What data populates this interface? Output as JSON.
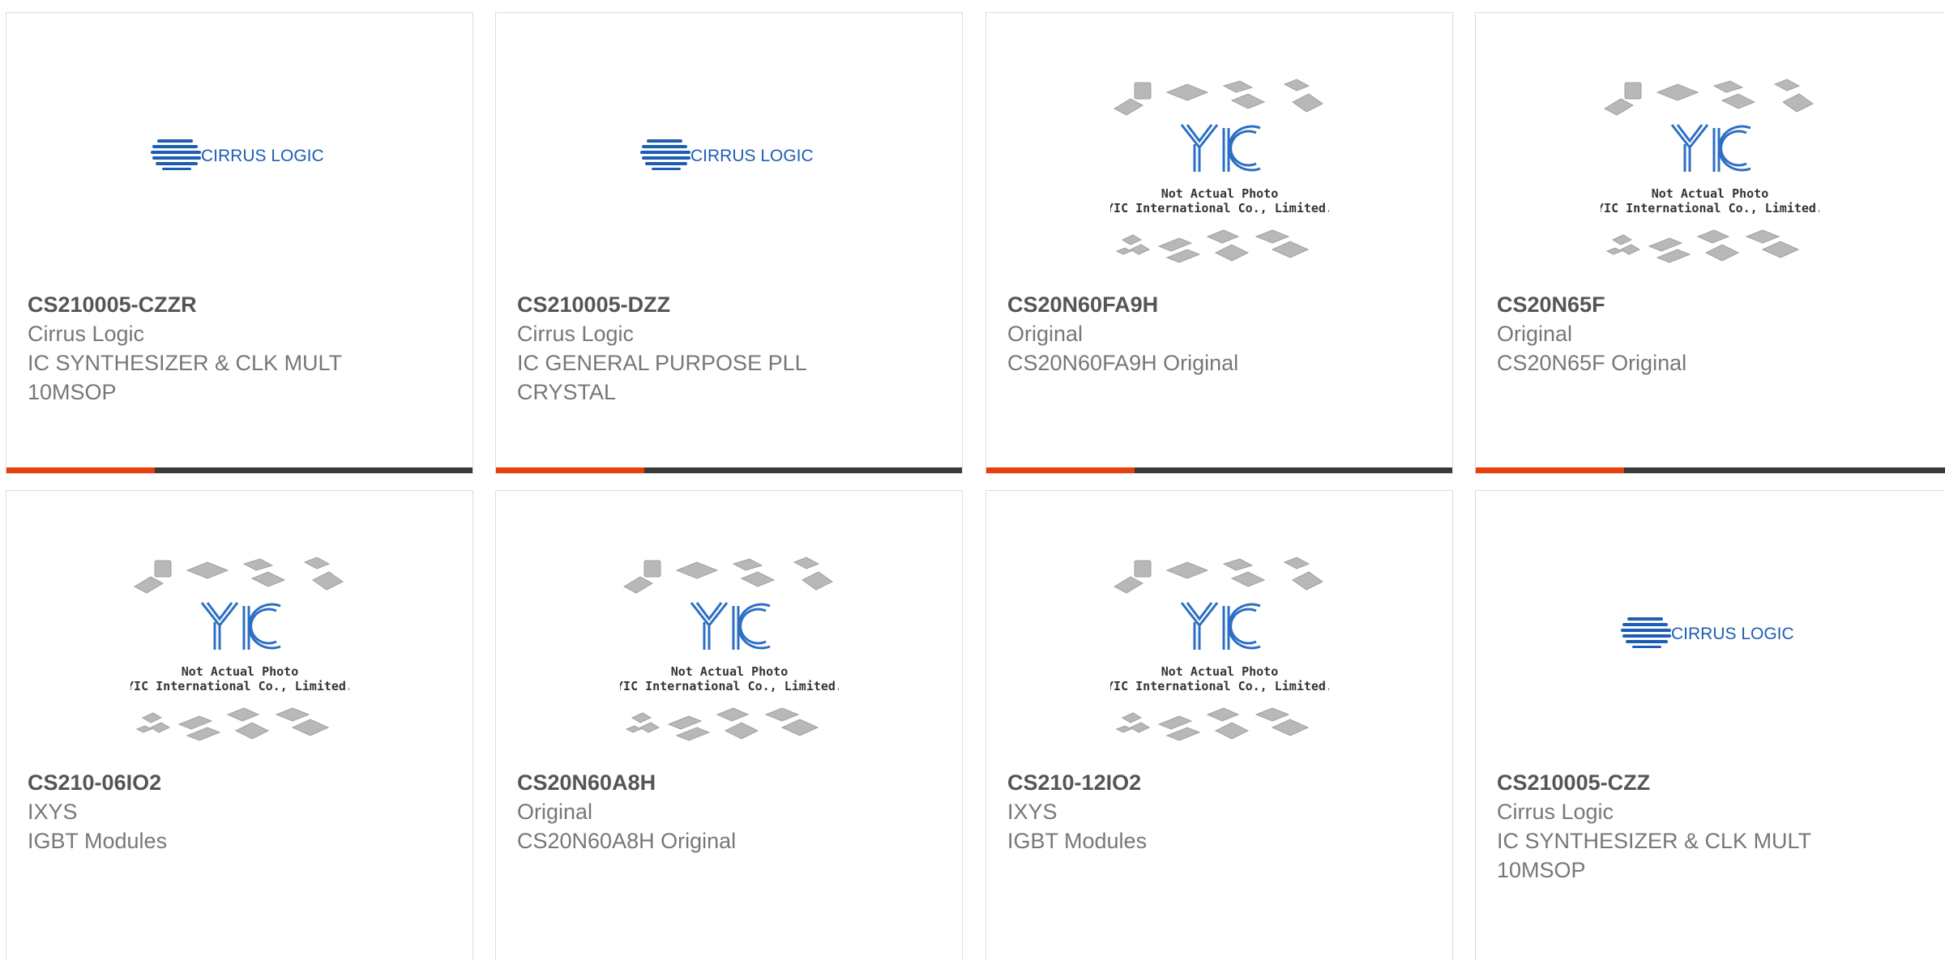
{
  "products": [
    {
      "part": "CS210005-CZZR",
      "manufacturer": "Cirrus Logic",
      "description": "IC SYNTHESIZER & CLK MULT 10MSOP",
      "image": "cirrus-logic-logo",
      "logo_text": "CIRRUS LOGIC"
    },
    {
      "part": "CS210005-DZZ",
      "manufacturer": "Cirrus Logic",
      "description": "IC GENERAL PURPOSE PLL CRYSTAL",
      "image": "cirrus-logic-logo",
      "logo_text": "CIRRUS LOGIC"
    },
    {
      "part": "CS20N60FA9H",
      "manufacturer": "Original",
      "description": "CS20N60FA9H Original",
      "image": "not-actual-photo",
      "placeholder_line1": "Not Actual Photo",
      "placeholder_line2": "YIC International Co., Limited.",
      "placeholder_logo": "YIC"
    },
    {
      "part": "CS20N65F",
      "manufacturer": "Original",
      "description": "CS20N65F Original",
      "image": "not-actual-photo",
      "placeholder_line1": "Not Actual Photo",
      "placeholder_line2": "YIC International Co., Limited.",
      "placeholder_logo": "YIC"
    },
    {
      "part": "CS210-06IO2",
      "manufacturer": "IXYS",
      "description": "IGBT Modules",
      "image": "not-actual-photo",
      "placeholder_line1": "Not Actual Photo",
      "placeholder_line2": "YIC International Co., Limited.",
      "placeholder_logo": "YIC"
    },
    {
      "part": "CS20N60A8H",
      "manufacturer": "Original",
      "description": "CS20N60A8H Original",
      "image": "not-actual-photo",
      "placeholder_line1": "Not Actual Photo",
      "placeholder_line2": "YIC International Co., Limited.",
      "placeholder_logo": "YIC"
    },
    {
      "part": "CS210-12IO2",
      "manufacturer": "IXYS",
      "description": "IGBT Modules",
      "image": "not-actual-photo",
      "placeholder_line1": "Not Actual Photo",
      "placeholder_line2": "YIC International Co., Limited.",
      "placeholder_logo": "YIC"
    },
    {
      "part": "CS210005-CZZ",
      "manufacturer": "Cirrus Logic",
      "description": "IC SYNTHESIZER & CLK MULT 10MSOP",
      "image": "cirrus-logic-logo",
      "logo_text": "CIRRUS LOGIC"
    }
  ],
  "colors": {
    "accent": "#e8400c",
    "bar": "#3a3a3a",
    "brand_blue": "#1d5db3",
    "chip_gray": "#b8b8b8"
  }
}
